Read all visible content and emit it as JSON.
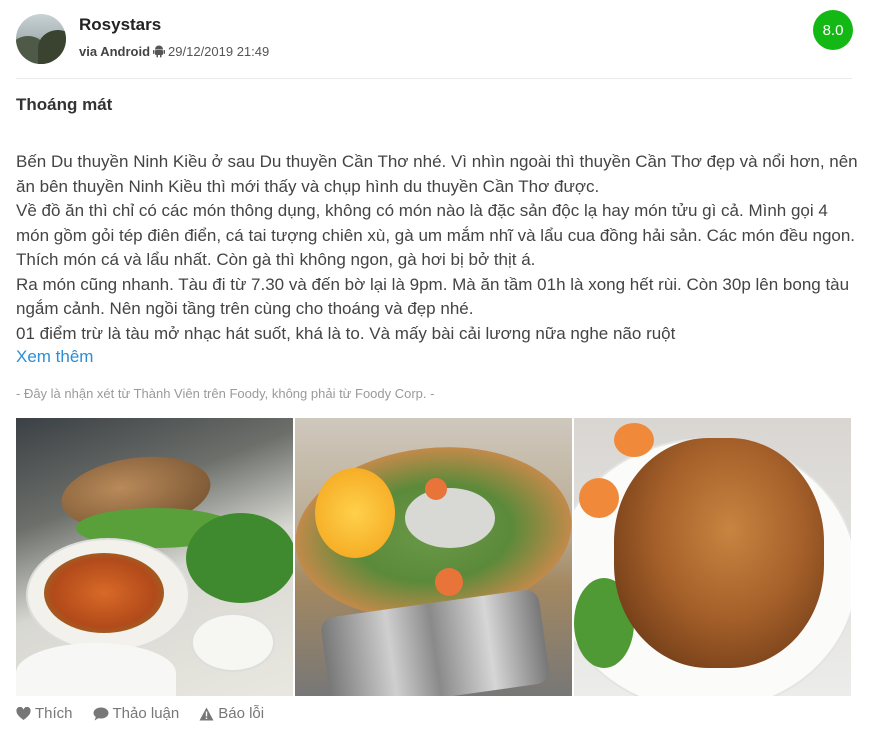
{
  "review": {
    "user": {
      "name": "Rosystars",
      "via_label": "via Android",
      "timestamp": "29/12/2019 21:49"
    },
    "score": "8.0",
    "score_color": "#14b814",
    "title": "Thoáng mát",
    "body": [
      "Bến Du thuyền Ninh Kiều ở sau Du thuyền Cần Thơ nhé. Vì nhìn ngoài thì thuyền Cần Thơ đẹp và nổi hơn, nên ăn bên thuyền Ninh Kiều thì mới thấy và chụp hình du thuyền Cần Thơ được.",
      "Về đồ ăn thì chỉ có các món thông dụng, không có món nào là đặc sản độc lạ hay món tửu gì cả. Mình gọi 4 món gồm gỏi tép điên điển, cá tai tượng chiên xù, gà um mắm nhĩ và lẩu cua đồng hải sản. Các món đều ngon. Thích món cá và lẩu nhất. Còn gà thì không ngon, gà hơi bị bở thịt á.",
      "Ra món cũng nhanh. Tàu đi từ 7.30 và đến bờ lại là 9pm. Mà ăn tầm 01h là xong hết rùi. Còn 30p lên bong tàu ngắm cảnh. Nên ngồi tầng trên cùng cho thoáng và đẹp nhé.",
      "01 điểm trừ là tàu mở nhạc hát suốt, khá là to. Và mấy bài cải lương nữa nghe não ruột"
    ],
    "see_more": "Xem thêm",
    "disclaimer": "- Đây là nhận xét từ Thành Viên trên Foody, không phải từ Foody Corp. -",
    "actions": {
      "like": "Thích",
      "discuss": "Thảo luận",
      "report": "Báo lỗi"
    },
    "accent_link_color": "#2c8dd6",
    "photos": [
      "fish-and-salad-table-photo",
      "hotpot-vegetable-platter-photo",
      "braised-chicken-plate-photo"
    ]
  }
}
